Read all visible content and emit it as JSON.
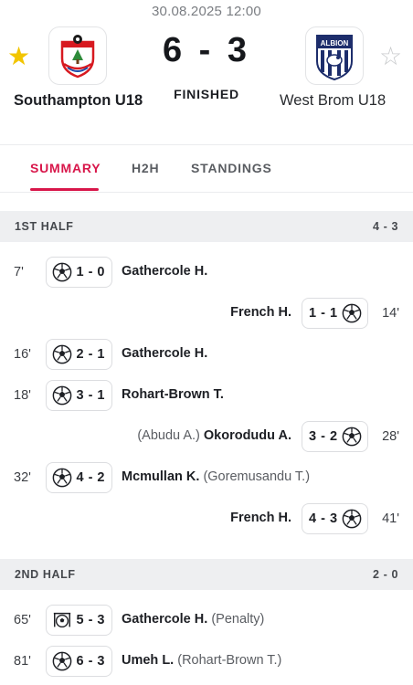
{
  "match": {
    "datetime": "30.08.2025 12:00",
    "score": "6 - 3",
    "status": "FINISHED",
    "home": {
      "name": "Southampton U18",
      "favorited": true,
      "logo": "southampton-crest"
    },
    "away": {
      "name": "West Brom U18",
      "favorited": false,
      "logo": "west-brom-albion-crest",
      "logo_text": "ALBION"
    }
  },
  "tabs": [
    {
      "label": "SUMMARY",
      "active": true
    },
    {
      "label": "H2H",
      "active": false
    },
    {
      "label": "STANDINGS",
      "active": false
    }
  ],
  "halves": [
    {
      "label": "1ST HALF",
      "score": "4 - 3",
      "events": [
        {
          "side": "home",
          "minute": "7'",
          "score": "1 - 0",
          "player": "Gathercole H.",
          "assist": "",
          "icon": "soccer-ball-icon"
        },
        {
          "side": "away",
          "minute": "14'",
          "score": "1 - 1",
          "player": "French H.",
          "assist": "",
          "icon": "soccer-ball-icon"
        },
        {
          "side": "home",
          "minute": "16'",
          "score": "2 - 1",
          "player": "Gathercole H.",
          "assist": "",
          "icon": "soccer-ball-icon"
        },
        {
          "side": "home",
          "minute": "18'",
          "score": "3 - 1",
          "player": "Rohart-Brown T.",
          "assist": "",
          "icon": "soccer-ball-icon"
        },
        {
          "side": "away",
          "minute": "28'",
          "score": "3 - 2",
          "player": "Okorodudu A.",
          "assist": "(Abudu A.)",
          "icon": "soccer-ball-icon"
        },
        {
          "side": "home",
          "minute": "32'",
          "score": "4 - 2",
          "player": "Mcmullan K.",
          "assist": "(Goremusandu T.)",
          "icon": "soccer-ball-icon"
        },
        {
          "side": "away",
          "minute": "41'",
          "score": "4 - 3",
          "player": "French H.",
          "assist": "",
          "icon": "soccer-ball-icon"
        }
      ]
    },
    {
      "label": "2ND HALF",
      "score": "2 - 0",
      "events": [
        {
          "side": "home",
          "minute": "65'",
          "score": "5 - 3",
          "player": "Gathercole H.",
          "assist": "(Penalty)",
          "icon": "penalty-goal-icon"
        },
        {
          "side": "home",
          "minute": "81'",
          "score": "6 - 3",
          "player": "Umeh L.",
          "assist": "(Rohart-Brown T.)",
          "icon": "soccer-ball-icon"
        }
      ]
    }
  ],
  "colors": {
    "accent": "#d8164a",
    "star_active": "#f2c500",
    "star_inactive": "#c8cacc",
    "header_bg": "#eeeff1"
  }
}
